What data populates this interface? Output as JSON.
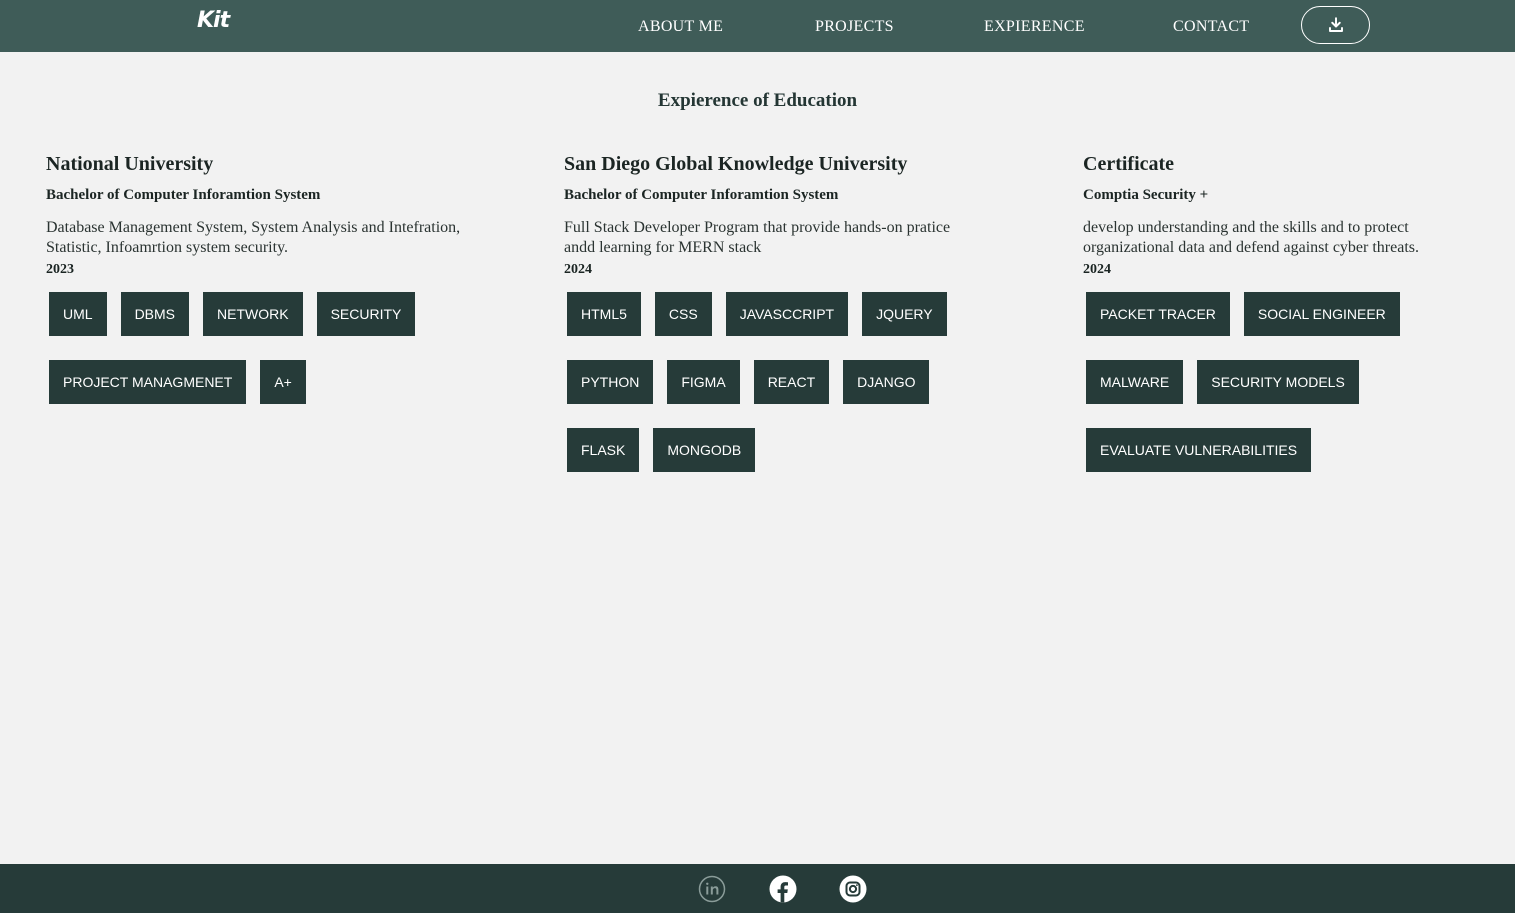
{
  "nav": {
    "logo": "Kit",
    "links": [
      "ABOUT ME",
      "PROJECTS",
      "EXPIERENCE",
      "CONTACT"
    ],
    "download_icon": "download-icon"
  },
  "page": {
    "title": "Expierence of Education"
  },
  "columns": [
    {
      "title": "National University",
      "degree": "Bachelor of Computer Inforamtion System",
      "description": "Database Management System, System Analysis and Intefration, Statistic, Infoamrtion system security.",
      "year": "2023",
      "tags": [
        "UML",
        "DBMS",
        "NETWORK",
        "SECURITY",
        "PROJECT MANAGMENET",
        "A+"
      ]
    },
    {
      "title": "San Diego Global Knowledge University",
      "degree": "Bachelor of Computer Inforamtion System",
      "description": "Full Stack Developer Program that provide hands-on pratice andd learning for MERN stack",
      "year": "2024",
      "tags": [
        "HTML5",
        "CSS",
        "JAVASCCRIPT",
        "JQUERY",
        "PYTHON",
        "FIGMA",
        "REACT",
        "DJANGO",
        "FLASK",
        "MONGODB"
      ]
    },
    {
      "title": "Certificate",
      "degree": "Comptia Security +",
      "description": "develop understanding and the skills and to protect organizational data and defend against cyber threats.",
      "year": "2024",
      "tags": [
        "PACKET TRACER",
        "SOCIAL ENGINEER",
        "MALWARE",
        "SECURITY MODELS",
        "EVALUATE VULNERABILITIES"
      ]
    }
  ],
  "footer": {
    "icons": [
      "linkedin-icon",
      "facebook-icon",
      "instagram-icon"
    ]
  },
  "colors": {
    "nav_bg": "#3f5c58",
    "footer_bg": "#263b39",
    "tag_bg": "#263b39",
    "page_bg": "#f2f2f2"
  }
}
